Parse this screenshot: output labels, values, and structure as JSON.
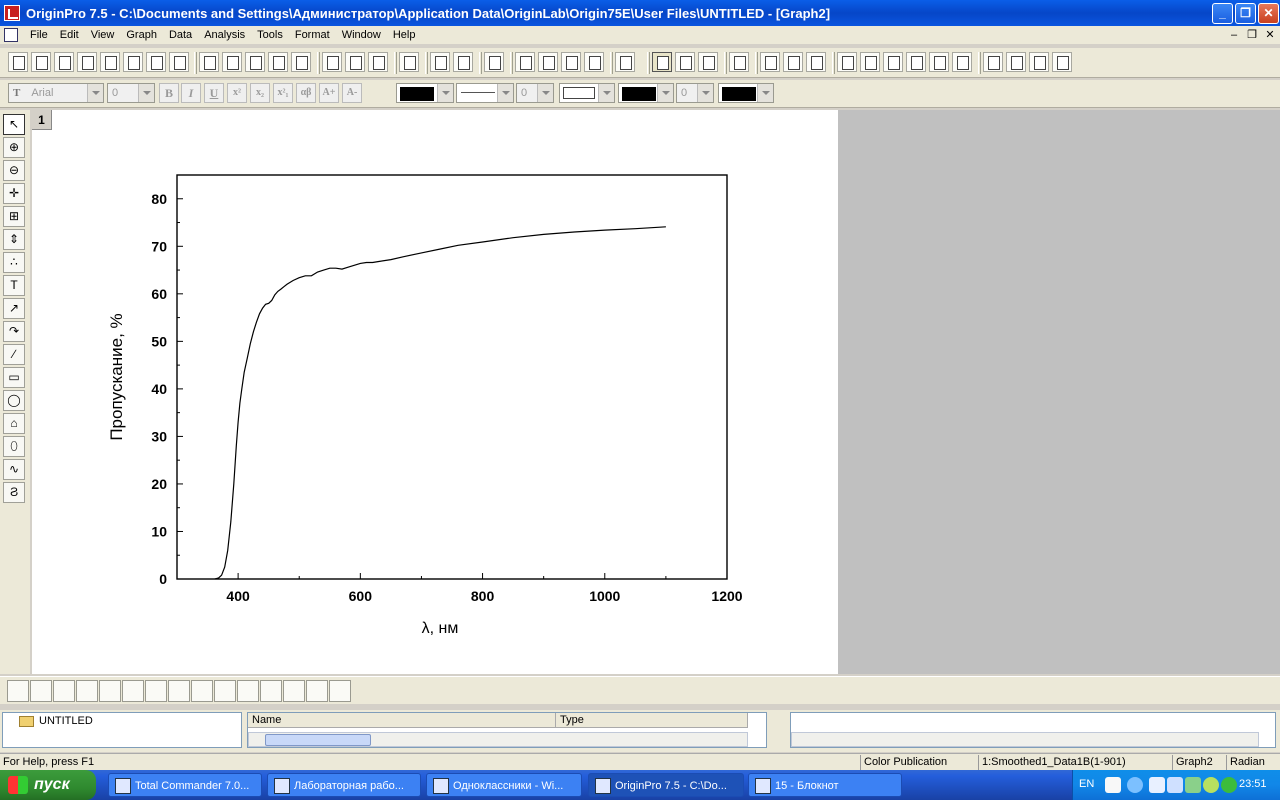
{
  "window": {
    "title": "OriginPro 7.5 - C:\\Documents and Settings\\Администратор\\Application Data\\OriginLab\\Origin75E\\User Files\\UNTITLED - [Graph2]",
    "minimize": "_",
    "restore": "❐",
    "close": "✕"
  },
  "menu": [
    "File",
    "Edit",
    "View",
    "Graph",
    "Data",
    "Analysis",
    "Tools",
    "Format",
    "Window",
    "Help"
  ],
  "mdi_controls": [
    "–",
    "❐",
    "✕"
  ],
  "format_toolbar": {
    "font_name": "Arial",
    "font_size": "0",
    "line_width": "0",
    "symbol_size": "0",
    "bold": "B",
    "italic": "I",
    "underline": "U",
    "superscript": "x²",
    "subscript": "x₂",
    "supsub": "x²₁",
    "greek": "αβ",
    "increase_font": "A+",
    "decrease_font": "A-"
  },
  "graph": {
    "layer_label": "1",
    "chart_data": {
      "type": "line",
      "xlabel": "λ, нм",
      "ylabel": "Пропускание, %",
      "xlim": [
        300,
        1200
      ],
      "ylim": [
        0,
        85
      ],
      "xticks": [
        400,
        600,
        800,
        1000,
        1200
      ],
      "yticks": [
        0,
        10,
        20,
        30,
        40,
        50,
        60,
        70,
        80
      ],
      "grid": false,
      "series": [
        {
          "x": [
            362,
            368,
            373,
            378,
            383,
            388,
            393,
            397,
            400,
            403,
            406,
            410,
            415,
            420,
            425,
            430,
            435,
            440,
            445,
            450,
            455,
            460,
            465,
            470,
            475,
            480,
            490,
            500,
            510,
            520,
            530,
            540,
            550,
            560,
            570,
            580,
            590,
            600,
            610,
            620,
            630,
            650,
            670,
            700,
            730,
            760,
            800,
            850,
            900,
            950,
            1000,
            1050,
            1100
          ],
          "y": [
            0,
            0.2,
            0.8,
            2.5,
            6,
            12,
            20,
            28,
            33,
            37,
            40,
            43.5,
            46.5,
            49.5,
            52,
            54,
            55.8,
            57,
            57.8,
            58,
            58.6,
            59.8,
            60.5,
            61,
            61.5,
            62,
            62.8,
            63.4,
            63.8,
            63.8,
            64.6,
            65,
            65.4,
            65.4,
            65.2,
            65.6,
            66,
            66.4,
            66.6,
            66.6,
            66.8,
            67.2,
            67.8,
            68.6,
            69.4,
            70.2,
            70.9,
            71.8,
            72.5,
            73,
            73.4,
            73.7,
            74.1
          ]
        }
      ]
    }
  },
  "project_explorer": {
    "folder": "UNTITLED",
    "columns": [
      "Name",
      "Type"
    ]
  },
  "status": {
    "help": "For Help, press F1",
    "theme": "Color Publication",
    "dataset": "1:Smoothed1_Data1B(1-901)",
    "window": "Graph2",
    "angle": "Radian"
  },
  "taskbar": {
    "start": "пуск",
    "tasks": [
      "Total Commander 7.0...",
      "Лабораторная рабо...",
      "Одноклассники - Wi...",
      "OriginPro 7.5 - C:\\Do...",
      "15 - Блокнот"
    ],
    "lang": "EN",
    "clock": "23:51"
  }
}
